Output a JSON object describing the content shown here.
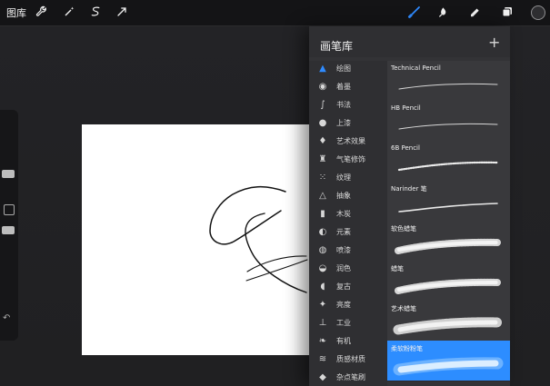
{
  "app": {
    "gallery_label": "图库"
  },
  "toolbar": {
    "left_tools": [
      "wrench-icon",
      "magic-wand-icon",
      "selection-icon",
      "transform-icon"
    ],
    "right_tools": [
      "brush-icon",
      "smudge-icon",
      "eraser-icon",
      "layers-icon",
      "color-icon"
    ],
    "accent_color": "#2f8bff"
  },
  "brush_library": {
    "title": "画笔库",
    "add_label": "+",
    "categories": [
      {
        "label": "绘图",
        "icon": "pen-nib-icon"
      },
      {
        "label": "着墨",
        "icon": "ink-drop-icon"
      },
      {
        "label": "书法",
        "icon": "calligraphy-icon"
      },
      {
        "label": "上漆",
        "icon": "paint-drop-icon"
      },
      {
        "label": "艺术效果",
        "icon": "art-brush-icon"
      },
      {
        "label": "气笔修饰",
        "icon": "airbrush-icon"
      },
      {
        "label": "纹理",
        "icon": "texture-icon"
      },
      {
        "label": "抽象",
        "icon": "triangle-icon"
      },
      {
        "label": "木炭",
        "icon": "charcoal-icon"
      },
      {
        "label": "元素",
        "icon": "element-icon"
      },
      {
        "label": "喷漆",
        "icon": "spray-icon"
      },
      {
        "label": "润色",
        "icon": "touchup-icon"
      },
      {
        "label": "复古",
        "icon": "retro-icon"
      },
      {
        "label": "亮度",
        "icon": "sparkle-icon"
      },
      {
        "label": "工业",
        "icon": "industrial-icon"
      },
      {
        "label": "有机",
        "icon": "leaf-icon"
      },
      {
        "label": "质感材质",
        "icon": "material-icon"
      },
      {
        "label": "杂点笔刷",
        "icon": "noise-icon"
      }
    ],
    "brushes": [
      {
        "name": "Technical Pencil",
        "stroke_style": "thin-line"
      },
      {
        "name": "HB Pencil",
        "stroke_style": "thin-line"
      },
      {
        "name": "6B Pencil",
        "stroke_style": "grain-line"
      },
      {
        "name": "Narinder 笔",
        "stroke_style": "curved-thin"
      },
      {
        "name": "软色蜡笔",
        "stroke_style": "textured-wide"
      },
      {
        "name": "蜡笔",
        "stroke_style": "textured-wide"
      },
      {
        "name": "艺术蜡笔",
        "stroke_style": "rough-wide"
      },
      {
        "name": "柔软粉粉笔",
        "stroke_style": "soft-wide",
        "selected": true
      }
    ]
  }
}
